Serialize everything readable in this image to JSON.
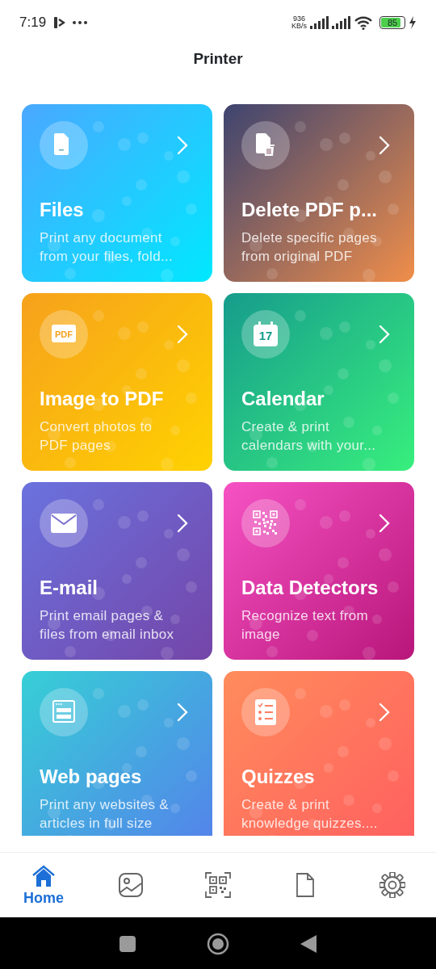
{
  "status_bar": {
    "time": "7:19",
    "speed_value": "936",
    "speed_unit": "KB/s",
    "battery": "85",
    "charging": true
  },
  "header": {
    "title": "Printer"
  },
  "cards": [
    {
      "kind": "file",
      "title": "Files",
      "description": [
        "Print any document",
        "from your files, fold..."
      ]
    },
    {
      "kind": "file-delete",
      "title": "Delete PDF p...",
      "description": [
        "Delete specific pages",
        "from original PDF"
      ]
    },
    {
      "kind": "pdf",
      "icon_label": "PDF",
      "title": "Image to PDF",
      "description": [
        "Convert photos to",
        "PDF pages"
      ]
    },
    {
      "kind": "calendar",
      "icon_label": "17",
      "title": "Calendar",
      "description": [
        "Create & print",
        "calendars with your..."
      ]
    },
    {
      "kind": "mail",
      "title": "E-mail",
      "description": [
        "Print email pages &",
        "files from email inbox"
      ]
    },
    {
      "kind": "qr",
      "title": "Data Detectors",
      "description": [
        "Recognize text from",
        "image"
      ]
    },
    {
      "kind": "browser",
      "title": "Web pages",
      "description": [
        "Print any websites &",
        "articles in full size"
      ]
    },
    {
      "kind": "checklist",
      "title": "Quizzes",
      "description": [
        "Create & print",
        "knowledge quizzes...."
      ]
    }
  ],
  "bottom_nav": [
    {
      "kind": "home",
      "label": "Home",
      "selected": true
    },
    {
      "kind": "gallery",
      "selected": false
    },
    {
      "kind": "qr",
      "selected": false
    },
    {
      "kind": "document",
      "selected": false
    },
    {
      "kind": "settings",
      "selected": false
    }
  ]
}
